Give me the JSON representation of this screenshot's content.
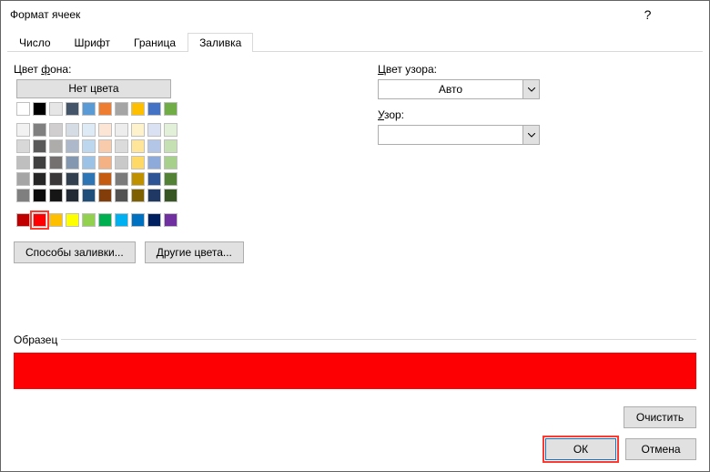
{
  "window": {
    "title": "Формат ячеек"
  },
  "tabs": {
    "number": "Число",
    "font": "Шрифт",
    "border": "Граница",
    "fill": "Заливка"
  },
  "fill": {
    "bg_label_pre": "Цвет ",
    "bg_label_u": "ф",
    "bg_label_post": "она:",
    "no_color": "Нет цвета",
    "fill_effects": "Способы заливки...",
    "more_colors": "Другие цвета..."
  },
  "pattern": {
    "color_label_pre": "",
    "color_label_u": "Ц",
    "color_label_post": "вет узора:",
    "auto": "Авто",
    "pattern_label_pre": "",
    "pattern_label_u": "У",
    "pattern_label_post": "зор:"
  },
  "sample": {
    "label": "Образец",
    "color": "#fd0003"
  },
  "buttons": {
    "clear": "Очистить",
    "ok": "ОК",
    "cancel": "Отмена"
  },
  "palette": {
    "row0": [
      "#ffffff",
      "#000000",
      "#e7e6e6",
      "#445569",
      "#5a9bd5",
      "#ee7d31",
      "#a5a5a5",
      "#febf00",
      "#4472c4",
      "#70ad47"
    ],
    "row1": [
      "#f2f2f2",
      "#808080",
      "#d0cece",
      "#d6dce4",
      "#deebf6",
      "#fce5d5",
      "#ededed",
      "#fef2cc",
      "#dae1f3",
      "#e2efd9"
    ],
    "row2": [
      "#d8d8d8",
      "#595959",
      "#aeabab",
      "#adb9ca",
      "#bdd7ee",
      "#f7cbac",
      "#dbdbdb",
      "#fee599",
      "#b4c6e7",
      "#c5e0b3"
    ],
    "row3": [
      "#bfbfbf",
      "#3f3f3f",
      "#757070",
      "#8497b0",
      "#9cc3e5",
      "#f4b183",
      "#c9c9c9",
      "#fed965",
      "#8eaadb",
      "#a8d08d"
    ],
    "row4": [
      "#a5a5a5",
      "#262626",
      "#3a3838",
      "#323f4f",
      "#2e75b5",
      "#c55a11",
      "#7b7b7b",
      "#bf9000",
      "#2f5496",
      "#538135"
    ],
    "row5": [
      "#7f7f7f",
      "#0c0c0c",
      "#171616",
      "#222a35",
      "#1e4e79",
      "#833d0b",
      "#525252",
      "#7f6000",
      "#1f3864",
      "#375623"
    ],
    "std": [
      "#c00000",
      "#fd0003",
      "#fdbf00",
      "#feff00",
      "#92d050",
      "#00b050",
      "#00b0f0",
      "#0070c0",
      "#002060",
      "#7030a0"
    ]
  }
}
